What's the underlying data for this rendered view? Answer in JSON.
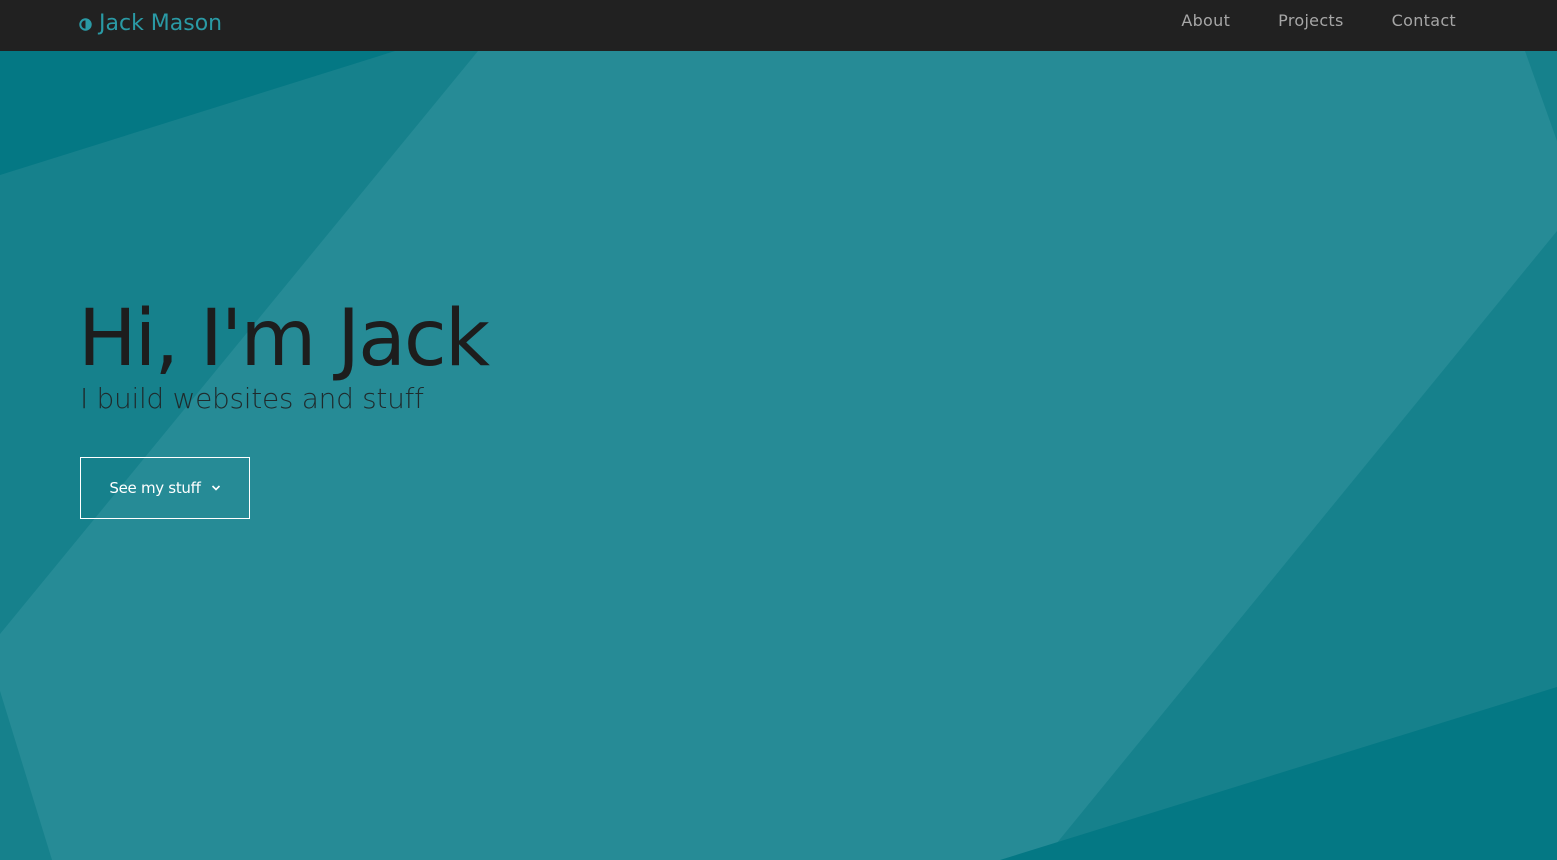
{
  "nav": {
    "brand_name": "Jack Mason",
    "brand_icon": "half-circle-icon",
    "brand_color": "#2a9aa5",
    "background": "#212121",
    "links": [
      {
        "label": "About"
      },
      {
        "label": "Projects"
      },
      {
        "label": "Contact"
      }
    ]
  },
  "hero": {
    "title": "Hi, I'm Jack",
    "subtitle": "I build websites and stuff",
    "cta_label": "See my stuff",
    "cta_icon": "chevron-down-icon",
    "background": "#268b96"
  }
}
